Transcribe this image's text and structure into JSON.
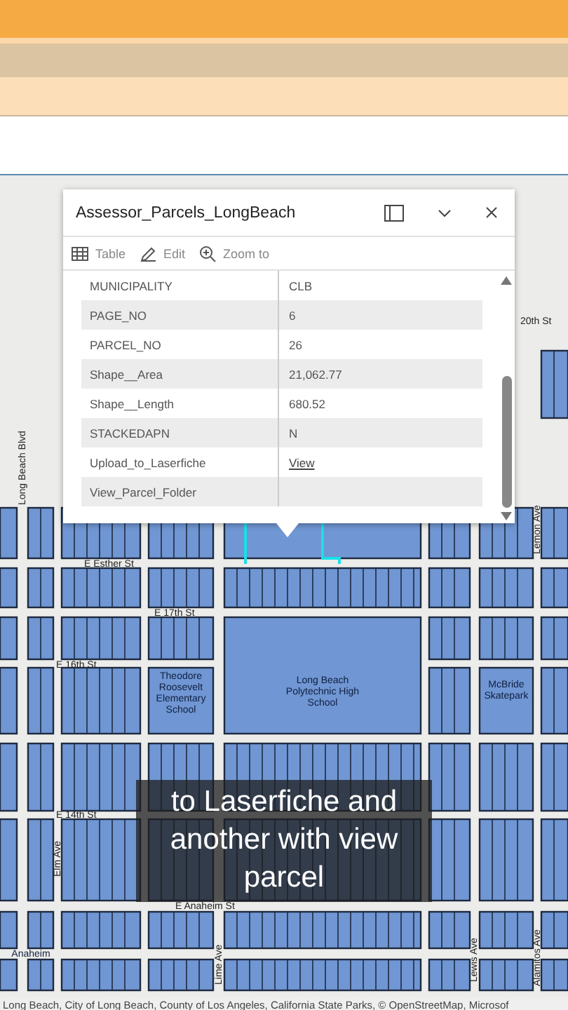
{
  "popup": {
    "title": "Assessor_Parcels_LongBeach",
    "actions": [
      {
        "label": "Table",
        "kind": "table"
      },
      {
        "label": "Edit",
        "kind": "edit"
      },
      {
        "label": "Zoom to",
        "kind": "zoom"
      }
    ],
    "fields": [
      {
        "name": "MUNICIPALITY",
        "value": "CLB",
        "kind": "text"
      },
      {
        "name": "PAGE_NO",
        "value": "6",
        "kind": "text"
      },
      {
        "name": "PARCEL_NO",
        "value": "26",
        "kind": "text"
      },
      {
        "name": "Shape__Area",
        "value": "21,062.77",
        "kind": "text"
      },
      {
        "name": "Shape__Length",
        "value": "680.52",
        "kind": "text"
      },
      {
        "name": "STACKEDAPN",
        "value": "N",
        "kind": "text"
      },
      {
        "name": "Upload_to_Laserfiche",
        "value": "View",
        "kind": "link"
      },
      {
        "name": "View_Parcel_Folder",
        "kind": "text"
      }
    ]
  },
  "map": {
    "labels": [
      {
        "text": "20th St",
        "kind": "street"
      },
      {
        "text": "Long Beach Blvd",
        "kind": "vstreet"
      },
      {
        "text": "E Esther St",
        "kind": "street"
      },
      {
        "text": "E 17th St",
        "kind": "street"
      },
      {
        "text": "E 16th St",
        "kind": "street"
      },
      {
        "text": "Theodore Roosevelt Elementary School",
        "kind": "place"
      },
      {
        "text": "Long Beach Polytechnic High School",
        "kind": "place"
      },
      {
        "text": "McBride Skatepark",
        "kind": "place"
      },
      {
        "text": "E 14th St",
        "kind": "street"
      },
      {
        "text": "E Anaheim St",
        "kind": "street"
      },
      {
        "text": "Elm Ave",
        "kind": "vstreet"
      },
      {
        "text": "Lime Ave",
        "kind": "vstreet"
      },
      {
        "text": "Lewis Ave",
        "kind": "vstreet"
      },
      {
        "text": "Lemon Ave",
        "kind": "vstreet"
      },
      {
        "text": "Alamitos Ave",
        "kind": "vstreet"
      },
      {
        "text": "Anaheim",
        "kind": "place"
      }
    ],
    "attribution": "Long Beach, City of Long Beach, County of Los Angeles, California State Parks, © OpenStreetMap, Microsof"
  },
  "caption": "to Laserfiche and another with view parcel"
}
